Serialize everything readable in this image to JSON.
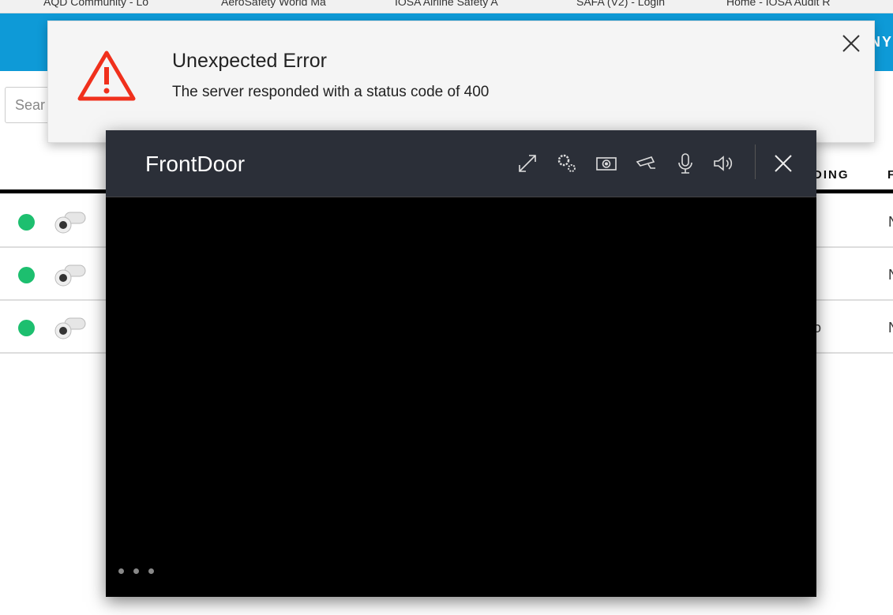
{
  "bookmarks": [
    "AQD Community - Lo",
    "AeroSafety World Ma",
    "IOSA Airline Safety A",
    "SAFA (V2) - Login",
    "Home - IOSA Audit R"
  ],
  "topbar": {
    "partial_text": "NY"
  },
  "search": {
    "placeholder": "Sear"
  },
  "table": {
    "headers": [
      "DING",
      "F"
    ],
    "rows": [
      {
        "status": "online",
        "last": "N",
        "mid": ""
      },
      {
        "status": "online",
        "last": "N",
        "mid": ""
      },
      {
        "status": "online",
        "last": "N",
        "mid": "o"
      }
    ]
  },
  "error": {
    "title": "Unexpected Error",
    "message": "The server responded with a status code of 400"
  },
  "player": {
    "title": "FrontDoor",
    "icons": [
      "fullscreen-icon",
      "settings-icon",
      "snapshot-icon",
      "camera-ptz-icon",
      "microphone-icon",
      "speaker-icon",
      "close-icon"
    ]
  },
  "colors": {
    "accent": "#0e9ad7",
    "online": "#1dbf6f",
    "error": "#f0301c",
    "player_header": "#2b2f38"
  }
}
